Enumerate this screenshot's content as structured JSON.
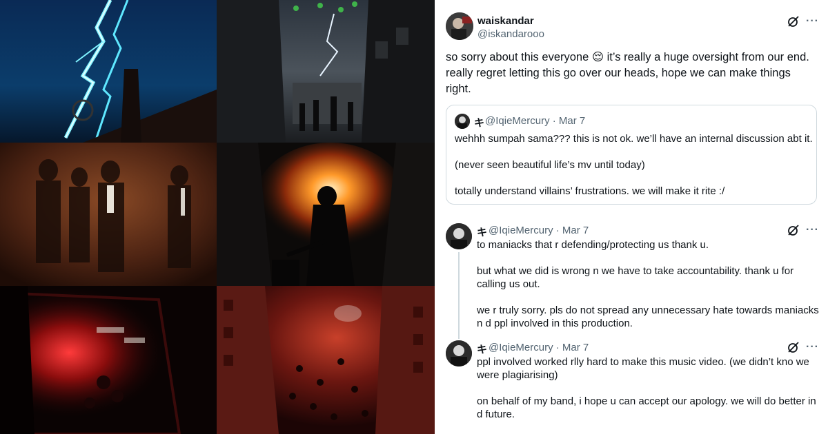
{
  "main_tweet": {
    "author_name": "waiskandar",
    "author_handle": "@iskandarooo",
    "text_lines": [
      "so sorry about this everyone 😌 it’s really a huge oversight from our end.",
      "really regret letting this go over our heads, hope we can make things",
      "right."
    ]
  },
  "quoted_tweet": {
    "name_glyph": "キ",
    "handle_date": "@IqieMercury · Mar 7",
    "lines": [
      "wehhh sumpah sama??? this is not ok. we’ll have an internal discussion abt it.",
      "(never seen beautiful life’s mv until today)",
      "totally understand villains’ frustrations. we will make it rite :/"
    ]
  },
  "replies": [
    {
      "name_glyph": "キ",
      "handle_date": "@IqieMercury · Mar 7",
      "lines": [
        "to maniacks that r defending/protecting us thank u.",
        "but what we did is wrong n we have to take accountability. thank u for",
        "calling us out.",
        "we r truly sorry. pls do not spread any unnecessary hate towards maniacks",
        "n d ppl involved in this production."
      ]
    },
    {
      "name_glyph": "キ",
      "handle_date": "@IqieMercury · Mar 7",
      "lines": [
        "ppl involved worked rlly hard to make this music video. (we didn’t kno we",
        "were plagiarising)",
        "on behalf of my band, i hope u can accept our apology. we will do better in",
        "d future."
      ]
    }
  ],
  "more_label": "···",
  "icons": {
    "grok": "grok-slash-circle-icon",
    "more": "more-dots-icon"
  },
  "colors": {
    "text": "#0f1419",
    "muted": "#536471",
    "border": "#cfd9de"
  }
}
